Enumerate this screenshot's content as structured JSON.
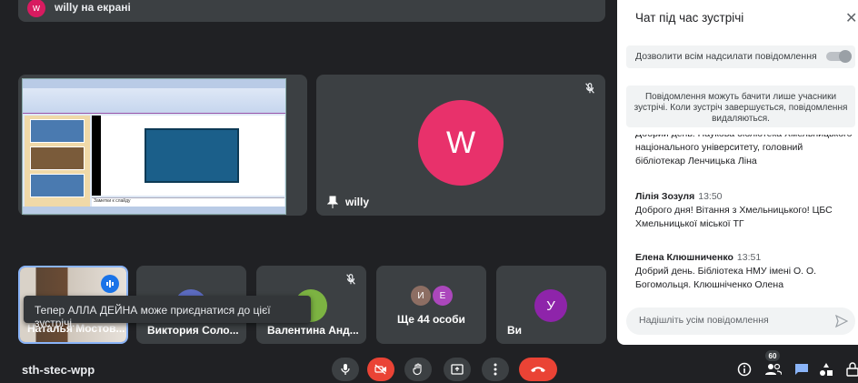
{
  "top_banner": {
    "avatar_letter": "w",
    "text": "willy на екрані"
  },
  "presentation": {
    "notes_text": "Заметки к слайду"
  },
  "tiles": {
    "willy": {
      "avatar_letter": "W",
      "name": "willy"
    },
    "natalya": {
      "name": "Наталья Мостов..."
    },
    "viktoriya": {
      "name": "Виктория Соло..."
    },
    "valentina": {
      "name": "Валентина Анд..."
    },
    "others": {
      "avatars": [
        "И",
        "Е"
      ],
      "label": "Ще 44 особи"
    },
    "you": {
      "avatar_letter": "У",
      "name": "Ви"
    }
  },
  "toast": {
    "text": "Тепер АЛЛА ДЕЙНА може приєднатися до цієї зустрічі."
  },
  "bottom_bar": {
    "meeting_code": "sth-stec-wpp",
    "participants_count": "60"
  },
  "chat": {
    "title": "Чат під час зустрічі",
    "close_icon": "close-icon",
    "allow_setting_label": "Дозволити всім надсилати повідомлення",
    "notice": "Повідомлення можуть бачити лише учасники зустрічі. Коли зустріч завершується, повідомлення видаляються.",
    "messages": [
      {
        "author": "",
        "time": "",
        "text": "Добрий день! Наукова бібліотека Хмельницького національного університету, головний бібліотекар Ленчицька Ліна"
      },
      {
        "author": "Лілія Зозуля",
        "time": "13:50",
        "text": "Доброго дня! Вітання з Хмельницького! ЦБС Хмельницької міської ТГ"
      },
      {
        "author": "Елена Клюшниченко",
        "time": "13:51",
        "text": "Добрий день. Бібліотека НМУ імені О. О. Богомольця. Клюшніченко Олена"
      }
    ],
    "input_placeholder": "Надішліть усім повідомлення"
  },
  "colors": {
    "background": "#202124",
    "tile": "#3c4043",
    "willy_avatar": "#e8316b",
    "end_call": "#ea4335",
    "accent": "#1a73e8",
    "chat_active": "#8ab4f8"
  }
}
